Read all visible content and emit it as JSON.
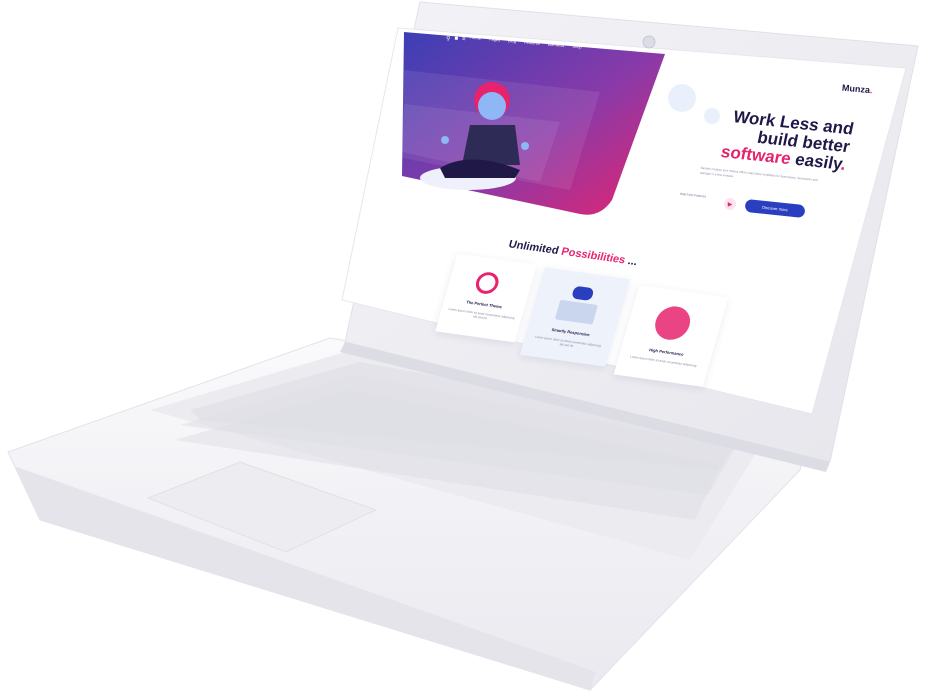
{
  "site": {
    "logo": "Munza",
    "logo_dot": ".",
    "nav_items": [
      "Home",
      "Pages",
      "Blog",
      "Features",
      "Elements",
      "Shop"
    ],
    "nav_icons": [
      "search-icon",
      "cart-icon",
      "menu-icon"
    ]
  },
  "hero": {
    "title_line1": "Work Less and",
    "title_line2": "build better",
    "title_accent": "software",
    "title_end": " easily",
    "title_dot": ".",
    "subtitle": "Sample creative text. Munza offers responsive templates for businesses, developers and startups in a few minutes.",
    "primary_button": "Discover more",
    "secondary_link": "Watch the Features"
  },
  "features": {
    "title_plain": "Unlimited ",
    "title_accent": "Possibilities",
    "title_suffix": " ...",
    "cards": [
      {
        "title": "High Performance",
        "text": "Lorem ipsum dolor sit amet consectetur adipiscing."
      },
      {
        "title": "Smartly Responsive",
        "text": "Lorem ipsum dolor sit amet consectetur adipiscing elit sed do."
      },
      {
        "title": "The Perfect Theme",
        "text": "Lorem ipsum dolor sit amet consectetur adipiscing elit sed do."
      }
    ]
  },
  "colors": {
    "accent": "#e8236e",
    "primary": "#2a3fbf",
    "dark": "#201948",
    "laptop_body": "#f4f4f7"
  }
}
